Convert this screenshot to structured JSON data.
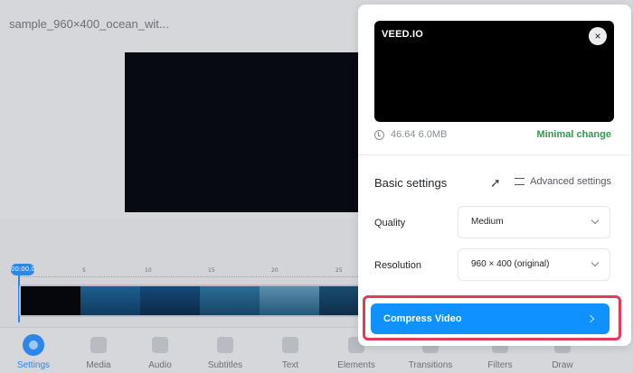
{
  "editor": {
    "file_title": "sample_960×400_ocean_wit...",
    "playhead_time": "00:00.0",
    "ruler_ticks": [
      "5",
      "10",
      "15",
      "20",
      "25"
    ]
  },
  "toolbar": {
    "items": [
      {
        "label": "Settings",
        "icon": "settings-icon",
        "active": true
      },
      {
        "label": "Media",
        "icon": "plus-icon"
      },
      {
        "label": "Audio",
        "icon": "music-note-icon"
      },
      {
        "label": "Subtitles",
        "icon": "subtitles-icon"
      },
      {
        "label": "Text",
        "icon": "text-icon"
      },
      {
        "label": "Elements",
        "icon": "elements-icon"
      },
      {
        "label": "Transitions",
        "icon": "transitions-icon"
      },
      {
        "label": "Filters",
        "icon": "filters-icon"
      },
      {
        "label": "Draw",
        "icon": "draw-icon"
      }
    ],
    "active_color": "#2e86e8"
  },
  "panel": {
    "brand": "VEED.IO",
    "close": "×",
    "duration_size": "46.64 6.0MB",
    "change_label": "Minimal change",
    "basic_settings": "Basic settings",
    "advanced_settings": "Advanced settings",
    "quality_label": "Quality",
    "quality_value": "Medium",
    "resolution_label": "Resolution",
    "resolution_value": "960 × 400 (original)",
    "compress_button": "Compress Video",
    "accent_color": "#0f92ff",
    "highlight_color": "#e23a5a",
    "change_color": "#2e9a4f"
  }
}
